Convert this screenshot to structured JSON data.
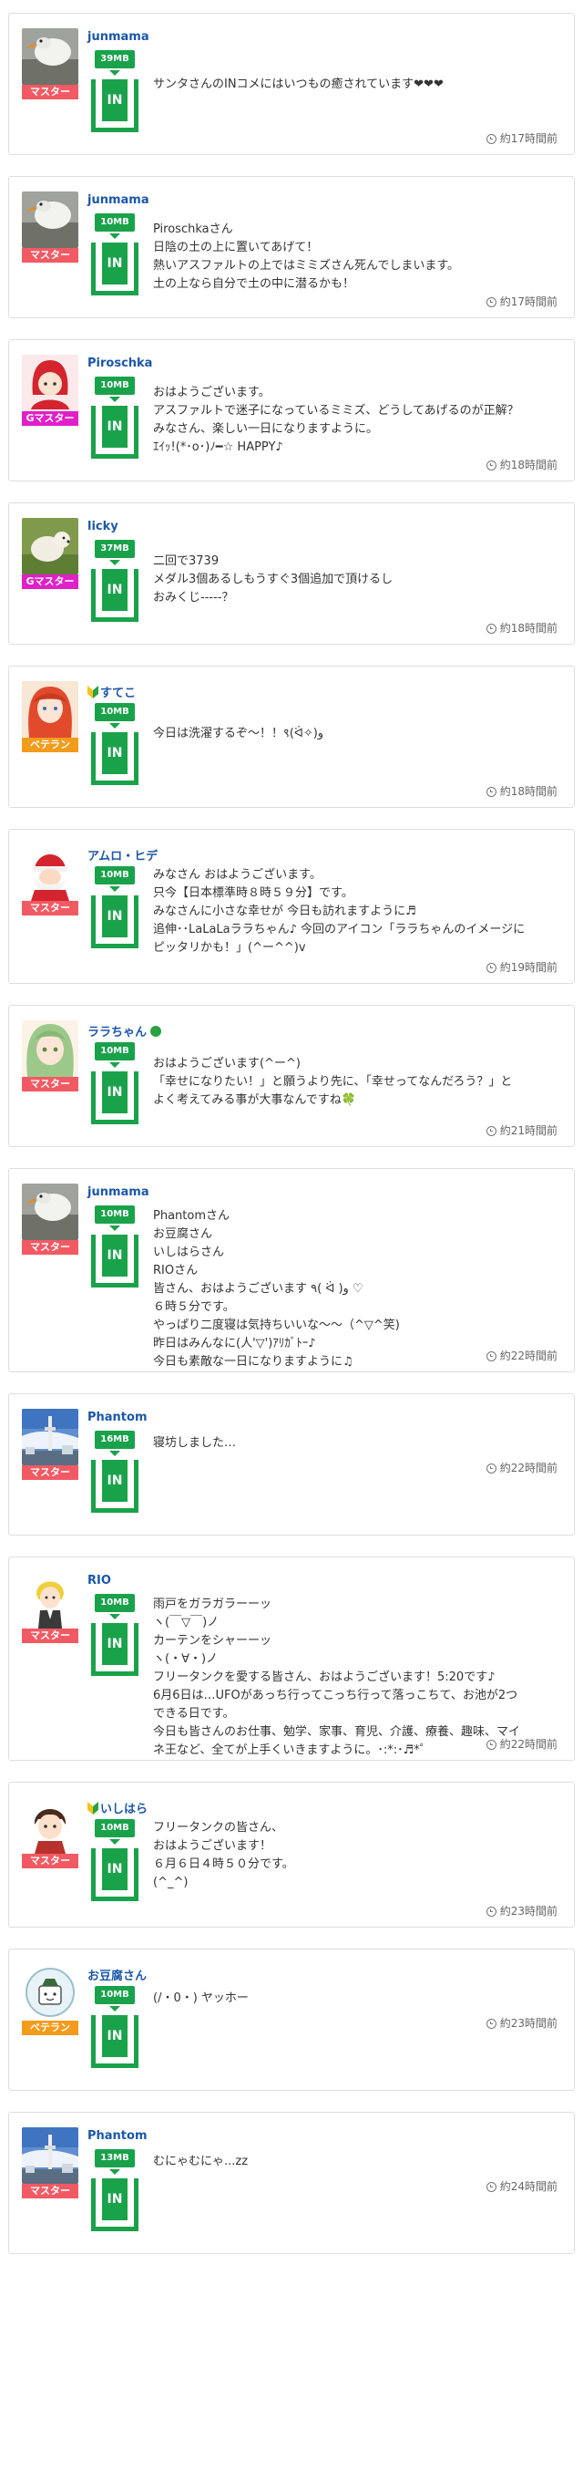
{
  "clock_icon": "clock-icon",
  "colors": {
    "user_name": "#1c57a8",
    "tank": "#1aa24b",
    "rank_master": "#f25a63",
    "rank_gmaster": "#e020c8",
    "rank_veteran": "#f39b1c"
  },
  "posts": [
    {
      "user": "junmama",
      "rank": "マスター",
      "size": "39MB",
      "in_label": "IN",
      "lines": [
        "サンタさんのINコメにはいつもの癒されています❤❤❤"
      ],
      "time": "約17時間前",
      "avatar_icon": "swan-avatar-icon"
    },
    {
      "user": "junmama",
      "rank": "マスター",
      "size": "10MB",
      "in_label": "IN",
      "lines": [
        "Piroschkaさん",
        "日陰の土の上に置いてあげて！",
        "熱いアスファルトの上ではミミズさん死んでしまいます。",
        "土の上なら自分で土の中に潜るかも！"
      ],
      "time": "約17時間前",
      "avatar_icon": "swan-avatar-icon"
    },
    {
      "user": "Piroschka",
      "rank": "Gマスター",
      "size": "10MB",
      "in_label": "IN",
      "lines": [
        "おはようございます。",
        "アスファルトで迷子になっているミミズ、どうしてあげるのが正解？",
        "みなさん、楽しい一日になりますように。",
        "ｴｲｯ!(*･o･)ﾉ━☆ HAPPY♪"
      ],
      "time": "約18時間前",
      "avatar_icon": "red-hood-avatar-icon"
    },
    {
      "user": "licky",
      "rank": "Gマスター",
      "size": "37MB",
      "in_label": "IN",
      "lines": [
        "二回で3739",
        "メダル3個あるしもうすぐ3個追加で頂けるし",
        "おみくじ-----？"
      ],
      "time": "約18時間前",
      "avatar_icon": "dog-avatar-icon"
    },
    {
      "user": "すてこ",
      "rank": "ベテラン",
      "size": "10MB",
      "in_label": "IN",
      "lines": [
        "今日は洗濯するぞ〜！！९(ᐛ✧)و"
      ],
      "time": "約18時間前",
      "avatar_icon": "anime-girl-avatar-icon",
      "beginner_mark": true
    },
    {
      "user": "アムロ・ヒデ",
      "rank": "マスター",
      "size": "10MB",
      "in_label": "IN",
      "lines": [
        "みなさん おはようございます。",
        "只今【日本標準時８時５９分】です。",
        "みなさんに小さな幸せが 今日も訪れますように♬",
        "追伸･･LaLaLaララちゃん♪ 今回のアイコン「ララちゃんのイメージに",
        "ピッタリかも！」(^ー^^)v"
      ],
      "time": "約19時間前",
      "avatar_icon": "santa-avatar-icon"
    },
    {
      "user": "ララちゃん",
      "rank": "マスター",
      "size": "10MB",
      "in_label": "IN",
      "lines": [
        "おはようございます(^ー^)",
        "「幸せになりたい！」と願うより先に、「幸せってなんだろう？」と",
        "よく考えてみる事が大事なんですね🍀"
      ],
      "time": "約21時間前",
      "avatar_icon": "anime-green-hair-avatar-icon",
      "check_badge": true
    },
    {
      "user": "junmama",
      "rank": "マスター",
      "size": "10MB",
      "in_label": "IN",
      "lines": [
        "Phantomさん",
        "お豆腐さん",
        "いしはらさん",
        "RIOさん",
        "皆さん、おはようございます ٩( ᐛ )و ♡",
        "６時５分です。",
        "やっぱり二度寝は気持ちいいな〜〜（^▽^笑)",
        "昨日はみんなに(人'▽')ｱﾘｶﾞﾄｰ♪",
        "今日も素敵な一日になりますように♫"
      ],
      "time": "約22時間前",
      "avatar_icon": "swan-avatar-icon"
    },
    {
      "user": "Phantom",
      "rank": "マスター",
      "size": "16MB",
      "in_label": "IN",
      "lines": [
        "寝坊しました…"
      ],
      "time": "約22時間前",
      "avatar_icon": "tower-avatar-icon"
    },
    {
      "user": "RIO",
      "rank": "マスター",
      "size": "10MB",
      "in_label": "IN",
      "lines": [
        "雨戸をガラガラーーッ",
        "ヽ(￣▽￣)ノ",
        "カーテンをシャーーッ",
        "ヽ(・∀・)ノ",
        "フリータンクを愛する皆さん、おはようございます！5:20です♪",
        "6月6日は…UFOがあっち行ってこっち行って落っこちて、お池が2つ",
        "できる日です。",
        "今日も皆さんのお仕事、勉学、家事、育児、介護、療養、趣味、マイ",
        "ネ王など、全てが上手くいきますように。･:*:･♬*゜"
      ],
      "time": "約22時間前",
      "avatar_icon": "character-avatar-icon"
    },
    {
      "user": "いしはら",
      "rank": "マスター",
      "size": "10MB",
      "in_label": "IN",
      "lines": [
        "フリータンクの皆さん、",
        "おはようございます！",
        "６月６日４時５０分です。",
        "(^_^)"
      ],
      "time": "約23時間前",
      "avatar_icon": "boy-avatar-icon",
      "beginner_mark": true
    },
    {
      "user": "お豆腐さん",
      "rank": "ベテラン",
      "size": "10MB",
      "in_label": "IN",
      "lines": [
        "(/・0・) ヤッホー"
      ],
      "time": "約23時間前",
      "avatar_icon": "tofu-avatar-icon"
    },
    {
      "user": "Phantom",
      "rank": "マスター",
      "size": "13MB",
      "in_label": "IN",
      "lines": [
        "むにゃむにゃ...zz"
      ],
      "time": "約24時間前",
      "avatar_icon": "tower-avatar-icon"
    }
  ]
}
